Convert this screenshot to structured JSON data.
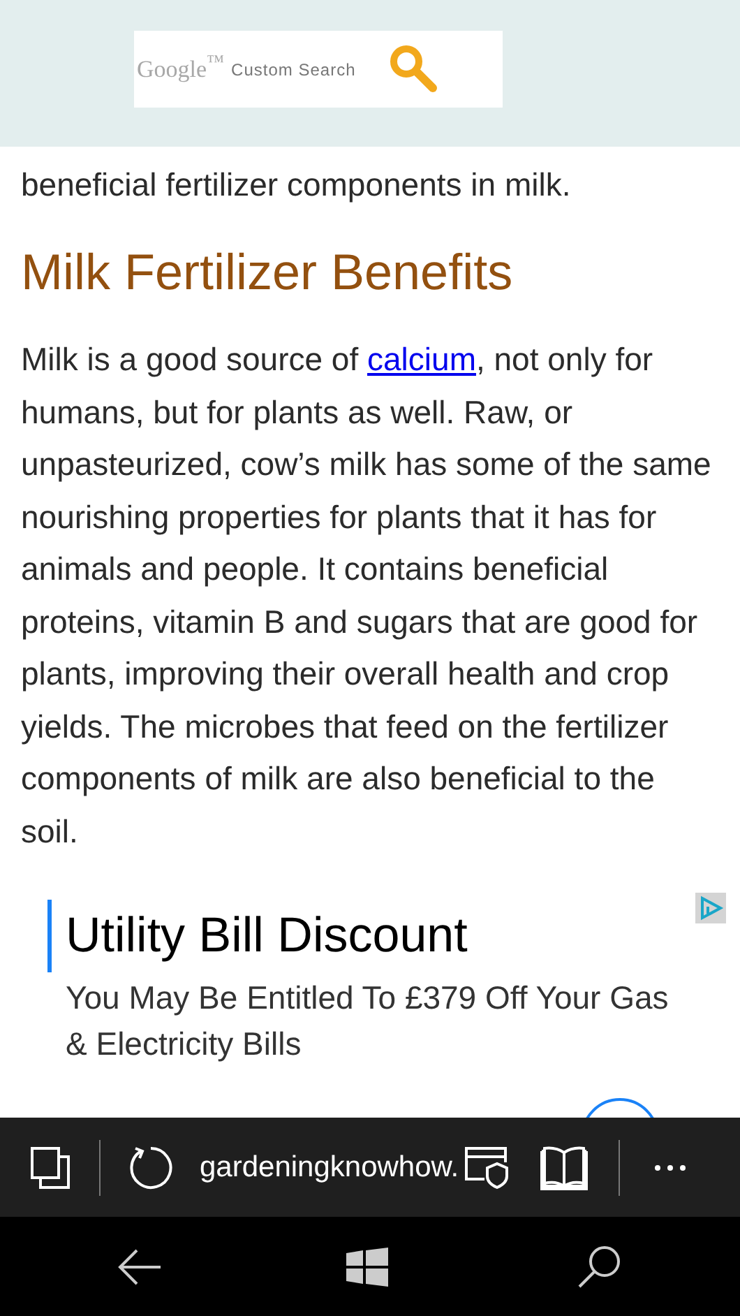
{
  "header": {
    "search_box": {
      "brand": "Google$^{™}$",
      "label": "Custom Search"
    }
  },
  "article": {
    "cut_line": "beneficial fertilizer components in milk.",
    "heading": "Milk Fertilizer Benefits",
    "paragraph": {
      "before": "Milk is a good source of ",
      "link": "calcium",
      "after": ", not only for humans, but for plants as well. Raw, or unpasteurized, cow’s milk has some of the same nourishing properties for plants that it has for animals and people. It contains beneficial proteins, vitamin B and sugars that are good for plants, improving their overall health and crop yields. The microbes that feed on the fertilizer components of milk are also beneficial to the soil."
    }
  },
  "ad": {
    "title": "Utility Bill Discount",
    "text": "You May Be Entitled To £379 Off Your Gas & Electricity Bills"
  },
  "browser_bar": {
    "address": "gardeningknowhow."
  }
}
